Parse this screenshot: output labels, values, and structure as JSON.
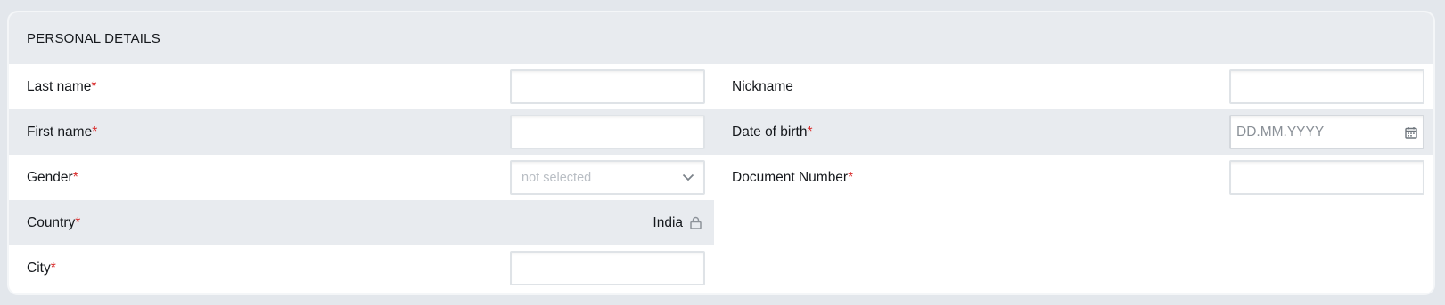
{
  "section": {
    "title": "PERSONAL DETAILS"
  },
  "left_fields": {
    "last_name": {
      "label": "Last name",
      "required_mark": "*",
      "value": ""
    },
    "first_name": {
      "label": "First name",
      "required_mark": "*",
      "value": ""
    },
    "gender": {
      "label": "Gender",
      "required_mark": "*",
      "selected": "not selected"
    },
    "country": {
      "label": "Country",
      "required_mark": "*",
      "value": "India"
    },
    "city": {
      "label": "City",
      "required_mark": "*",
      "value": ""
    }
  },
  "right_fields": {
    "nickname": {
      "label": "Nickname",
      "value": ""
    },
    "date_of_birth": {
      "label": "Date of birth",
      "required_mark": "*",
      "placeholder": "DD.MM.YYYY"
    },
    "document_number": {
      "label": "Document Number",
      "required_mark": "*",
      "value": ""
    }
  },
  "icons": {
    "gender_dropdown": "chevron-down-icon",
    "country_locked": "lock-icon",
    "date_picker": "calendar-icon"
  },
  "colors": {
    "required": "#d92b2b",
    "row_shade": "#e8ebef",
    "page_bg": "#e3e7ec"
  }
}
